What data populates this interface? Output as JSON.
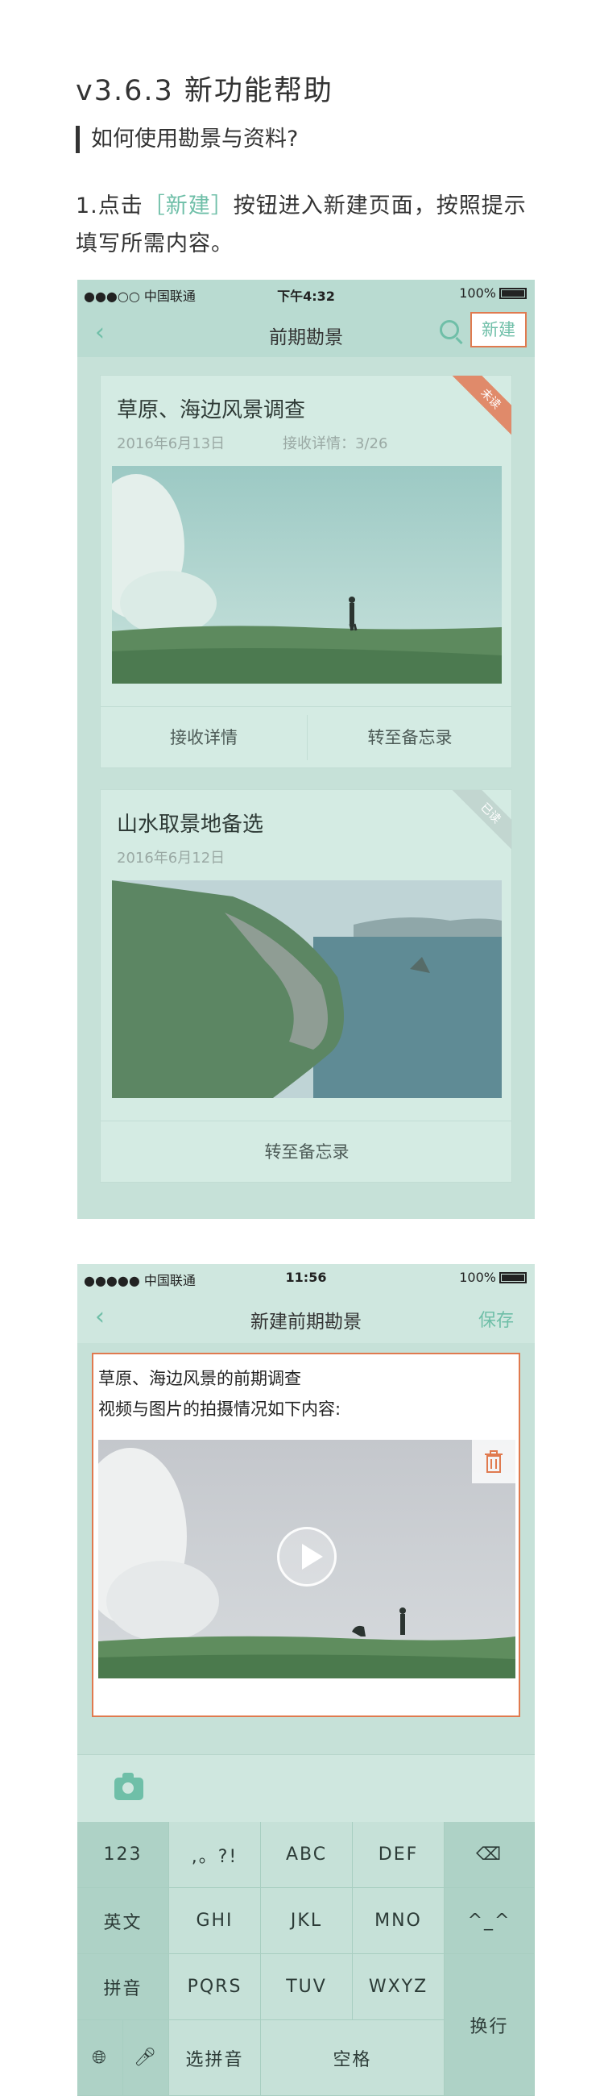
{
  "doc": {
    "version_title": "v3.6.3 新功能帮助",
    "subtitle": "如何使用勘景与资料?",
    "step_prefix": "1.点击",
    "step_highlight": "［新建］",
    "step_rest": "按钮进入新建页面，按照提示填写所需内容。"
  },
  "phone1": {
    "status": {
      "carrier": "●●●○○ 中国联通",
      "time": "下午4:32",
      "battery": "100%"
    },
    "nav": {
      "title": "前期勘景",
      "new_label": "新建"
    },
    "cards": [
      {
        "title": "草原、海边风景调查",
        "date": "2016年6月13日",
        "detail": "接收详情：3/26",
        "ribbon": "未读",
        "actions": [
          "接收详情",
          "转至备忘录"
        ]
      },
      {
        "title": "山水取景地备选",
        "date": "2016年6月12日",
        "ribbon": "已读",
        "actions": [
          "转至备忘录"
        ]
      }
    ]
  },
  "phone2": {
    "status": {
      "carrier": "●●●●● 中国联通",
      "time": "11:56",
      "battery": "100%"
    },
    "nav": {
      "title": "新建前期勘景",
      "save_label": "保存"
    },
    "editor": {
      "line1": "草原、海边风景的前期调查",
      "line2": "视频与图片的拍摄情况如下内容:"
    },
    "keyboard": {
      "k_123": "123",
      "k_punct": ",。?!",
      "k_abc": "ABC",
      "k_def": "DEF",
      "k_en": "英文",
      "k_ghi": "GHI",
      "k_jkl": "JKL",
      "k_mno": "MNO",
      "k_emoji": "^_^",
      "k_pinyin": "拼音",
      "k_pqrs": "PQRS",
      "k_tuv": "TUV",
      "k_wxyz": "WXYZ",
      "k_enter": "换行",
      "k_select": "选拼音",
      "k_space": "空格"
    }
  },
  "colors": {
    "accent": "#6fbfa8",
    "highlight_border": "#e07a4f",
    "bg": "#c6e1d8"
  }
}
